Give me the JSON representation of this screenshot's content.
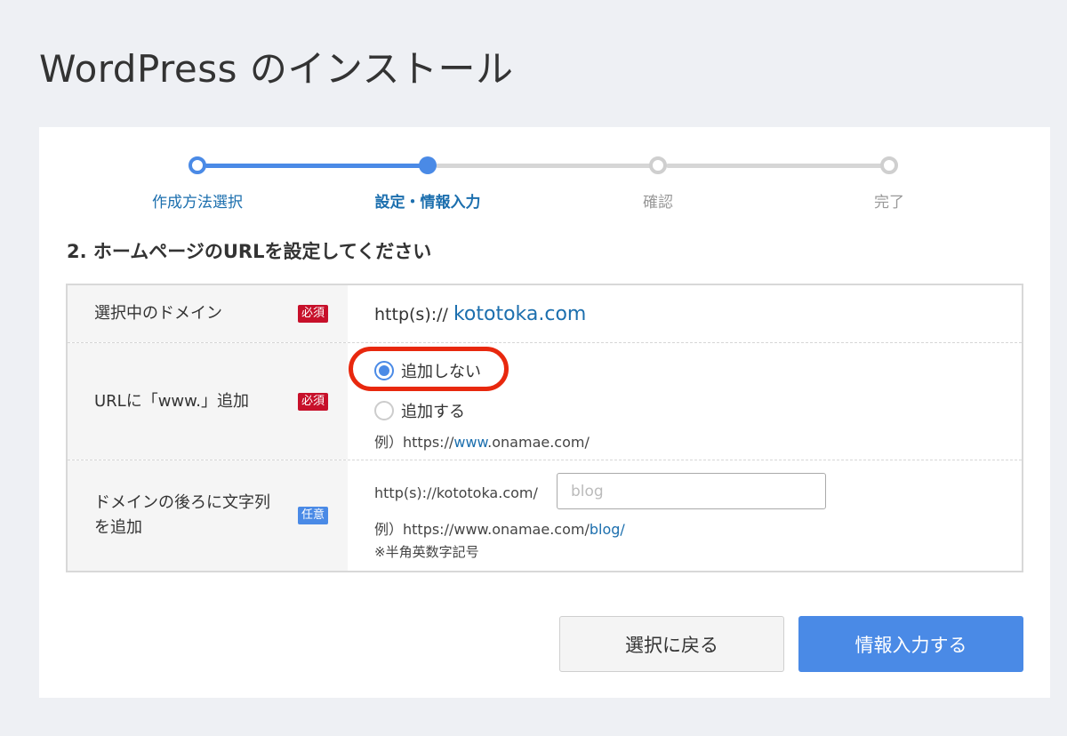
{
  "page": {
    "title": "WordPress のインストール"
  },
  "stepper": {
    "steps": [
      {
        "label": "作成方法選択",
        "state": "done"
      },
      {
        "label": "設定・情報入力",
        "state": "current"
      },
      {
        "label": "確認",
        "state": "pending"
      },
      {
        "label": "完了",
        "state": "pending"
      }
    ],
    "colors": {
      "active": "#4a8ae6",
      "pending": "#cfcfcf",
      "done_label": "#1c6fae",
      "pending_label": "#999999"
    }
  },
  "section": {
    "title": "2. ホームページのURLを設定してください"
  },
  "form": {
    "domain_row": {
      "label": "選択中のドメイン",
      "badge": "必須",
      "prefix": "http(s)://",
      "domain": "kototoka.com"
    },
    "www_row": {
      "label": "URLに「www.」追加",
      "badge": "必須",
      "options": [
        {
          "label": "追加しない",
          "checked": true
        },
        {
          "label": "追加する",
          "checked": false
        }
      ],
      "example_prefix": "例）https://",
      "example_highlight": "www",
      "example_suffix": ".onamae.com/"
    },
    "path_row": {
      "label_line1": "ドメインの後ろに文字列",
      "label_line2": "を追加",
      "badge": "任意",
      "prefix": "http(s)://kototoka.com/",
      "input_value": "",
      "input_placeholder": "blog",
      "example_prefix": "例）https://www.onamae.com/",
      "example_highlight": "blog/",
      "note": "※半角英数字記号"
    }
  },
  "buttons": {
    "back": "選択に戻る",
    "next": "情報入力する"
  },
  "colors": {
    "accent": "#4a8ae6",
    "required_badge": "#c7102a",
    "highlight_oval": "#e8280e",
    "link": "#1c6fae"
  }
}
